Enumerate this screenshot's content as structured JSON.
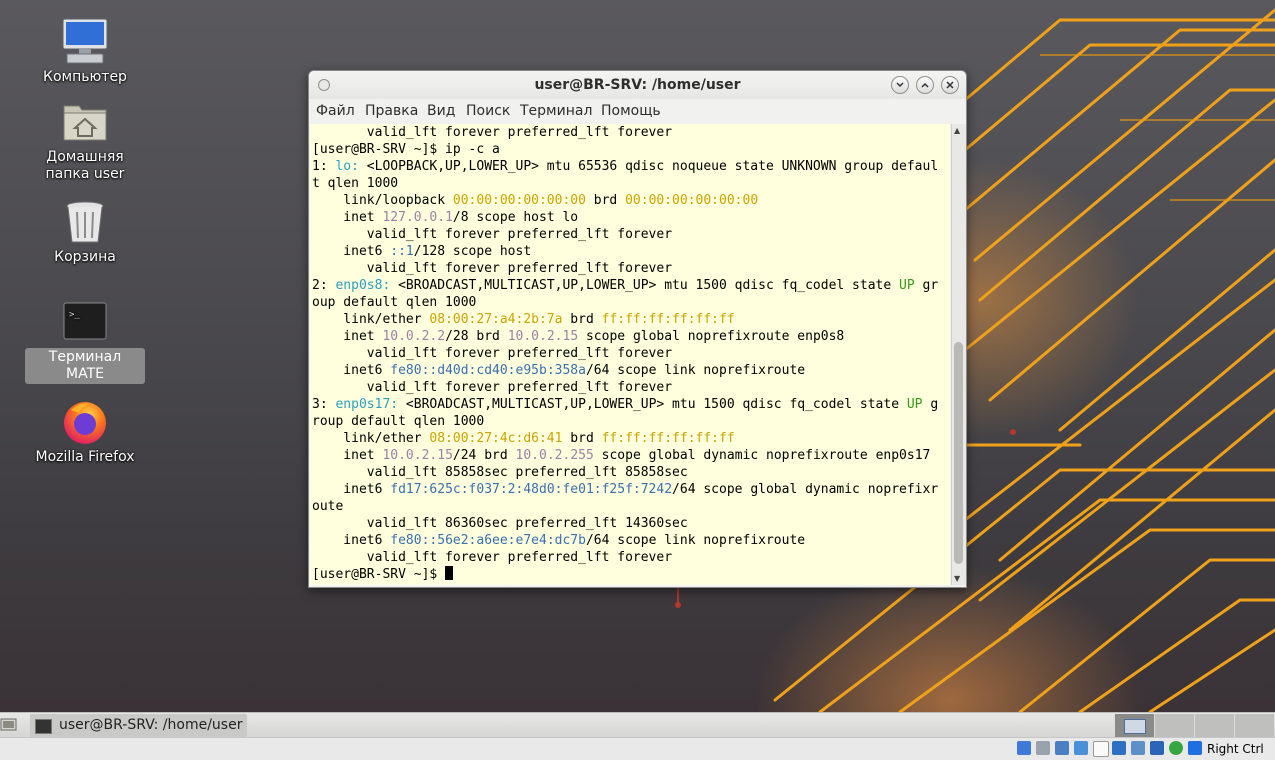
{
  "desktop": {
    "icons": [
      {
        "label": "Компьютер",
        "icon": "computer-icon"
      },
      {
        "label": "Домашняя папка user",
        "icon": "home-folder-icon"
      },
      {
        "label": "Корзина",
        "icon": "trash-icon"
      },
      {
        "label": "Терминал MATE",
        "icon": "terminal-icon"
      },
      {
        "label": "Mozilla Firefox",
        "icon": "firefox-icon"
      }
    ]
  },
  "window": {
    "title": "user@BR-SRV: /home/user",
    "menu": [
      "Файл",
      "Правка",
      "Вид",
      "Поиск",
      "Терминал",
      "Помощь"
    ],
    "buttons": [
      "minimize",
      "maximize",
      "close"
    ]
  },
  "terminal": {
    "lines": [
      [
        {
          "t": "       valid_lft forever preferred_lft forever"
        }
      ],
      [
        {
          "t": "[user@BR-SRV ~]$ ip -c a"
        }
      ],
      [
        {
          "t": "1: "
        },
        {
          "t": "lo:",
          "c": "cyan"
        },
        {
          "t": " <LOOPBACK,UP,LOWER_UP> mtu 65536 qdisc noqueue state UNKNOWN group defaul"
        }
      ],
      [
        {
          "t": "t qlen 1000"
        }
      ],
      [
        {
          "t": "    link/loopback "
        },
        {
          "t": "00:00:00:00:00:00",
          "c": "yellow"
        },
        {
          "t": " brd "
        },
        {
          "t": "00:00:00:00:00:00",
          "c": "yellow"
        }
      ],
      [
        {
          "t": "    inet "
        },
        {
          "t": "127.0.0.1",
          "c": "purple"
        },
        {
          "t": "/8 scope host lo"
        }
      ],
      [
        {
          "t": "       valid_lft forever preferred_lft forever"
        }
      ],
      [
        {
          "t": "    inet6 "
        },
        {
          "t": "::1",
          "c": "blue"
        },
        {
          "t": "/128 scope host"
        }
      ],
      [
        {
          "t": "       valid_lft forever preferred_lft forever"
        }
      ],
      [
        {
          "t": "2: "
        },
        {
          "t": "enp0s8:",
          "c": "cyan"
        },
        {
          "t": " <BROADCAST,MULTICAST,UP,LOWER_UP> mtu 1500 qdisc fq_codel state "
        },
        {
          "t": "UP",
          "c": "green"
        },
        {
          "t": " gr"
        }
      ],
      [
        {
          "t": "oup default qlen 1000"
        }
      ],
      [
        {
          "t": "    link/ether "
        },
        {
          "t": "08:00:27:a4:2b:7a",
          "c": "yellow"
        },
        {
          "t": " brd "
        },
        {
          "t": "ff:ff:ff:ff:ff:ff",
          "c": "yellow"
        }
      ],
      [
        {
          "t": "    inet "
        },
        {
          "t": "10.0.2.2",
          "c": "purple"
        },
        {
          "t": "/28 brd "
        },
        {
          "t": "10.0.2.15",
          "c": "purple"
        },
        {
          "t": " scope global noprefixroute enp0s8"
        }
      ],
      [
        {
          "t": "       valid_lft forever preferred_lft forever"
        }
      ],
      [
        {
          "t": "    inet6 "
        },
        {
          "t": "fe80::d40d:cd40:e95b:358a",
          "c": "blue"
        },
        {
          "t": "/64 scope link noprefixroute"
        }
      ],
      [
        {
          "t": "       valid_lft forever preferred_lft forever"
        }
      ],
      [
        {
          "t": "3: "
        },
        {
          "t": "enp0s17:",
          "c": "cyan"
        },
        {
          "t": " <BROADCAST,MULTICAST,UP,LOWER_UP> mtu 1500 qdisc fq_codel state "
        },
        {
          "t": "UP",
          "c": "green"
        },
        {
          "t": " g"
        }
      ],
      [
        {
          "t": "roup default qlen 1000"
        }
      ],
      [
        {
          "t": "    link/ether "
        },
        {
          "t": "08:00:27:4c:d6:41",
          "c": "yellow"
        },
        {
          "t": " brd "
        },
        {
          "t": "ff:ff:ff:ff:ff:ff",
          "c": "yellow"
        }
      ],
      [
        {
          "t": "    inet "
        },
        {
          "t": "10.0.2.15",
          "c": "purple"
        },
        {
          "t": "/24 brd "
        },
        {
          "t": "10.0.2.255",
          "c": "purple"
        },
        {
          "t": " scope global dynamic noprefixroute enp0s17"
        }
      ],
      [
        {
          "t": "       valid_lft 85858sec preferred_lft 85858sec"
        }
      ],
      [
        {
          "t": "    inet6 "
        },
        {
          "t": "fd17:625c:f037:2:48d0:fe01:f25f:7242",
          "c": "blue"
        },
        {
          "t": "/64 scope global dynamic noprefixr"
        }
      ],
      [
        {
          "t": "oute"
        }
      ],
      [
        {
          "t": "       valid_lft 86360sec preferred_lft 14360sec"
        }
      ],
      [
        {
          "t": "    inet6 "
        },
        {
          "t": "fe80::56e2:a6ee:e7e4:dc7b",
          "c": "blue"
        },
        {
          "t": "/64 scope link noprefixroute"
        }
      ],
      [
        {
          "t": "       valid_lft forever preferred_lft forever"
        }
      ],
      [
        {
          "t": "[user@BR-SRV ~]$ "
        }
      ]
    ]
  },
  "taskbar": {
    "task_label": "user@BR-SRV: /home/user",
    "workspaces": 4,
    "active_workspace": 1
  },
  "vbox_status": {
    "host_key": "Right Ctrl"
  }
}
